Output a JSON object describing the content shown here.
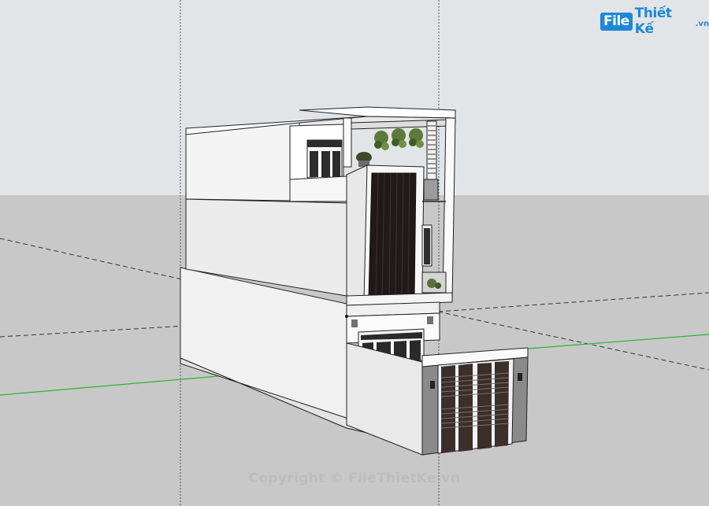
{
  "scene": {
    "description_colors": {
      "sky": "#e2e5e8",
      "ground": "#c8c8c8",
      "wall": "#efefef",
      "wall_shade": "#d9d9d9",
      "axis_green": "#2bb52b",
      "axis_dashed": "#333333",
      "stone": "#8a8a8a",
      "louver_dark": "#3a2f2a"
    }
  },
  "logo": {
    "file_text": "File",
    "brand_text": "Thiết Kế",
    "suffix_text": ".vn"
  },
  "watermark": {
    "text": "Copyright © FileThietKe.vn"
  }
}
